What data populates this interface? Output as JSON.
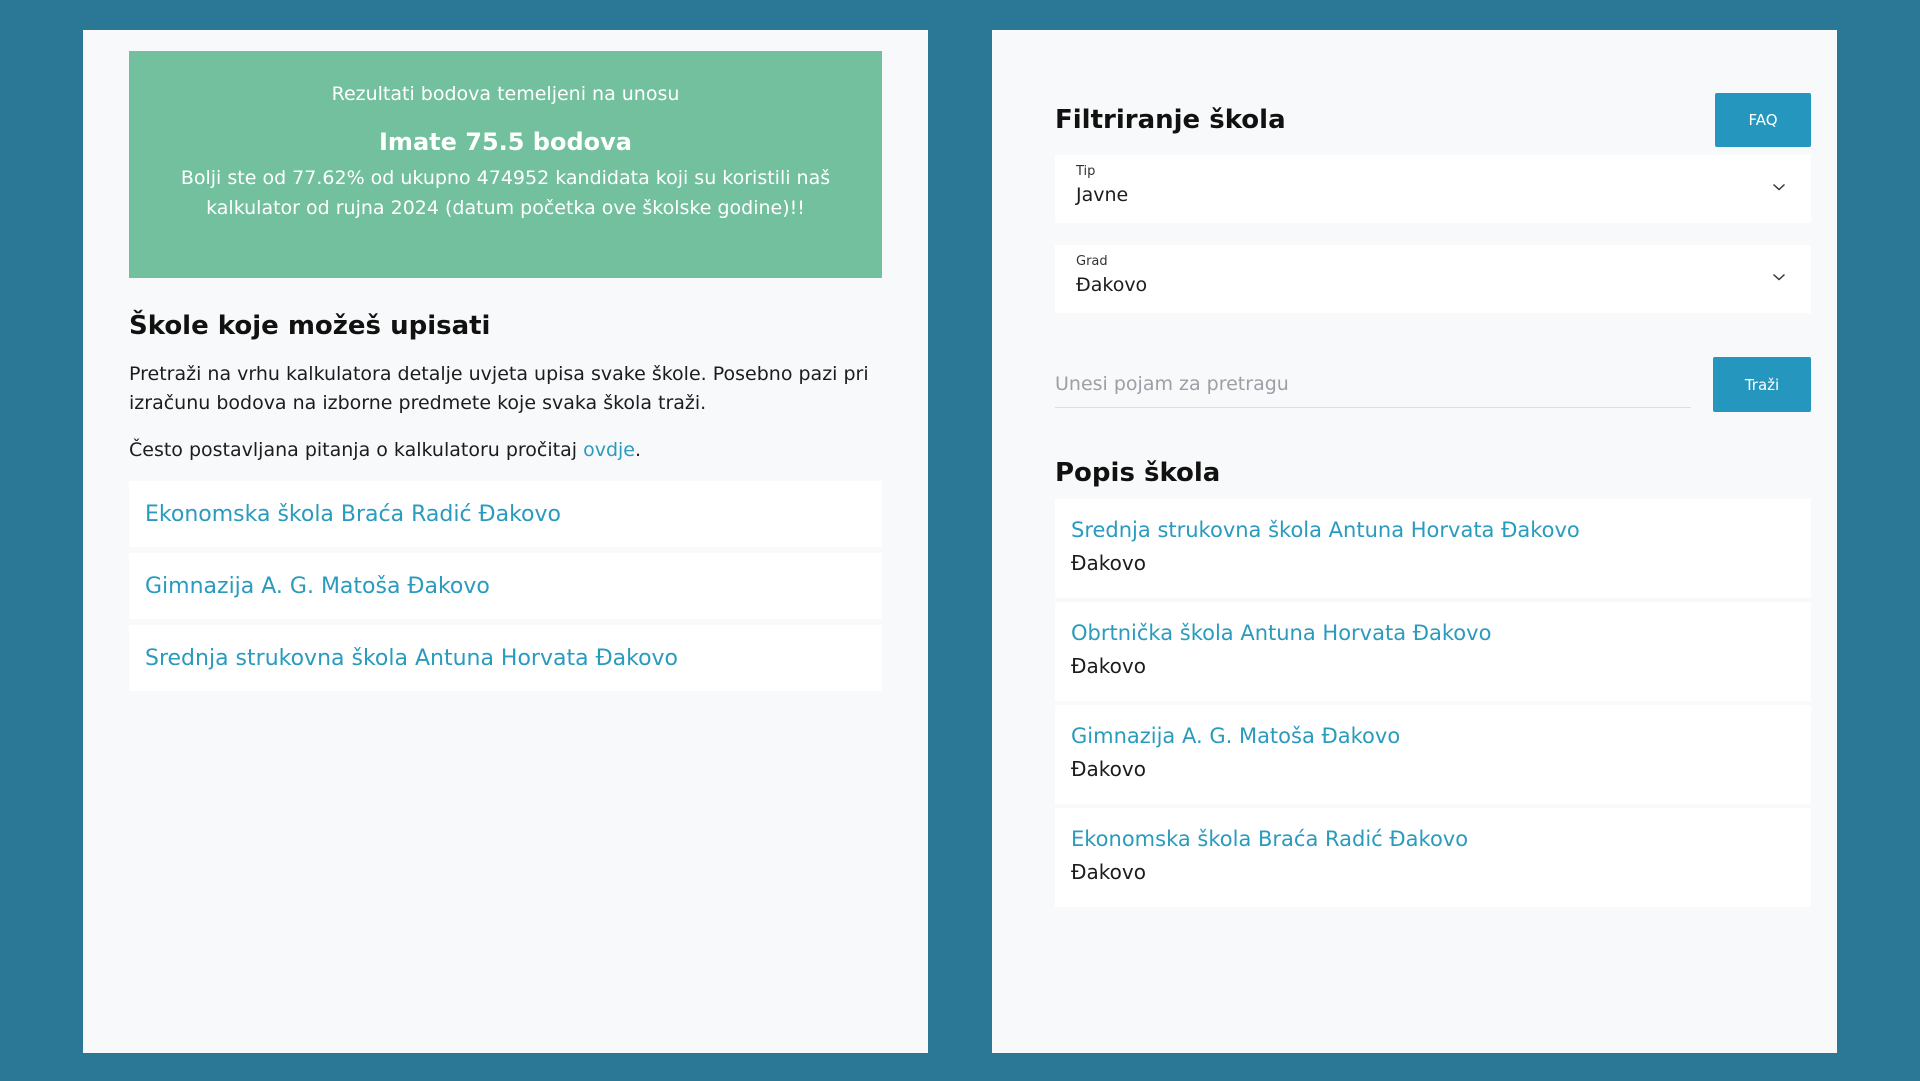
{
  "results": {
    "intro": "Rezultati bodova temeljeni na unosu",
    "score": "Imate 75.5 bodova",
    "detail": "Bolji ste od 77.62% od ukupno 474952 kandidata koji su koristili naš kalkulator od rujna 2024 (datum početka ove školske godine)!!"
  },
  "left": {
    "title": "Škole koje možeš upisati",
    "description": "Pretraži na vrhu kalkulatora detalje uvjeta upisa svake škole. Posebno pazi pri izračunu bodova na izborne predmete koje svaka škola traži.",
    "faq_prefix": "Često postavljana pitanja o kalkulatoru pročitaj ",
    "faq_link": "ovdje",
    "faq_suffix": ".",
    "schools": [
      "Ekonomska škola Braća Radić Đakovo",
      "Gimnazija A. G. Matoša Đakovo",
      "Srednja strukovna škola Antuna Horvata Đakovo"
    ]
  },
  "right": {
    "title": "Filtriranje škola",
    "faq_button": "FAQ",
    "tip": {
      "label": "Tip",
      "value": "Javne"
    },
    "grad": {
      "label": "Grad",
      "value": "Đakovo"
    },
    "search": {
      "placeholder": "Unesi pojam za pretragu",
      "value": "",
      "button": "Traži"
    },
    "list_title": "Popis škola",
    "schools": [
      {
        "name": "Srednja strukovna škola Antuna Horvata Đakovo",
        "city": "Đakovo"
      },
      {
        "name": "Obrtnička škola Antuna Horvata Đakovo",
        "city": "Đakovo"
      },
      {
        "name": "Gimnazija A. G. Matoša Đakovo",
        "city": "Đakovo"
      },
      {
        "name": "Ekonomska škola Braća Radić Đakovo",
        "city": "Đakovo"
      }
    ]
  },
  "icons": {
    "select_arrow": "chevron-down-icon"
  },
  "colors": {
    "background": "#2b7896",
    "results_box": "#72c09d",
    "link": "#2a9bbd",
    "button": "#2596be"
  }
}
